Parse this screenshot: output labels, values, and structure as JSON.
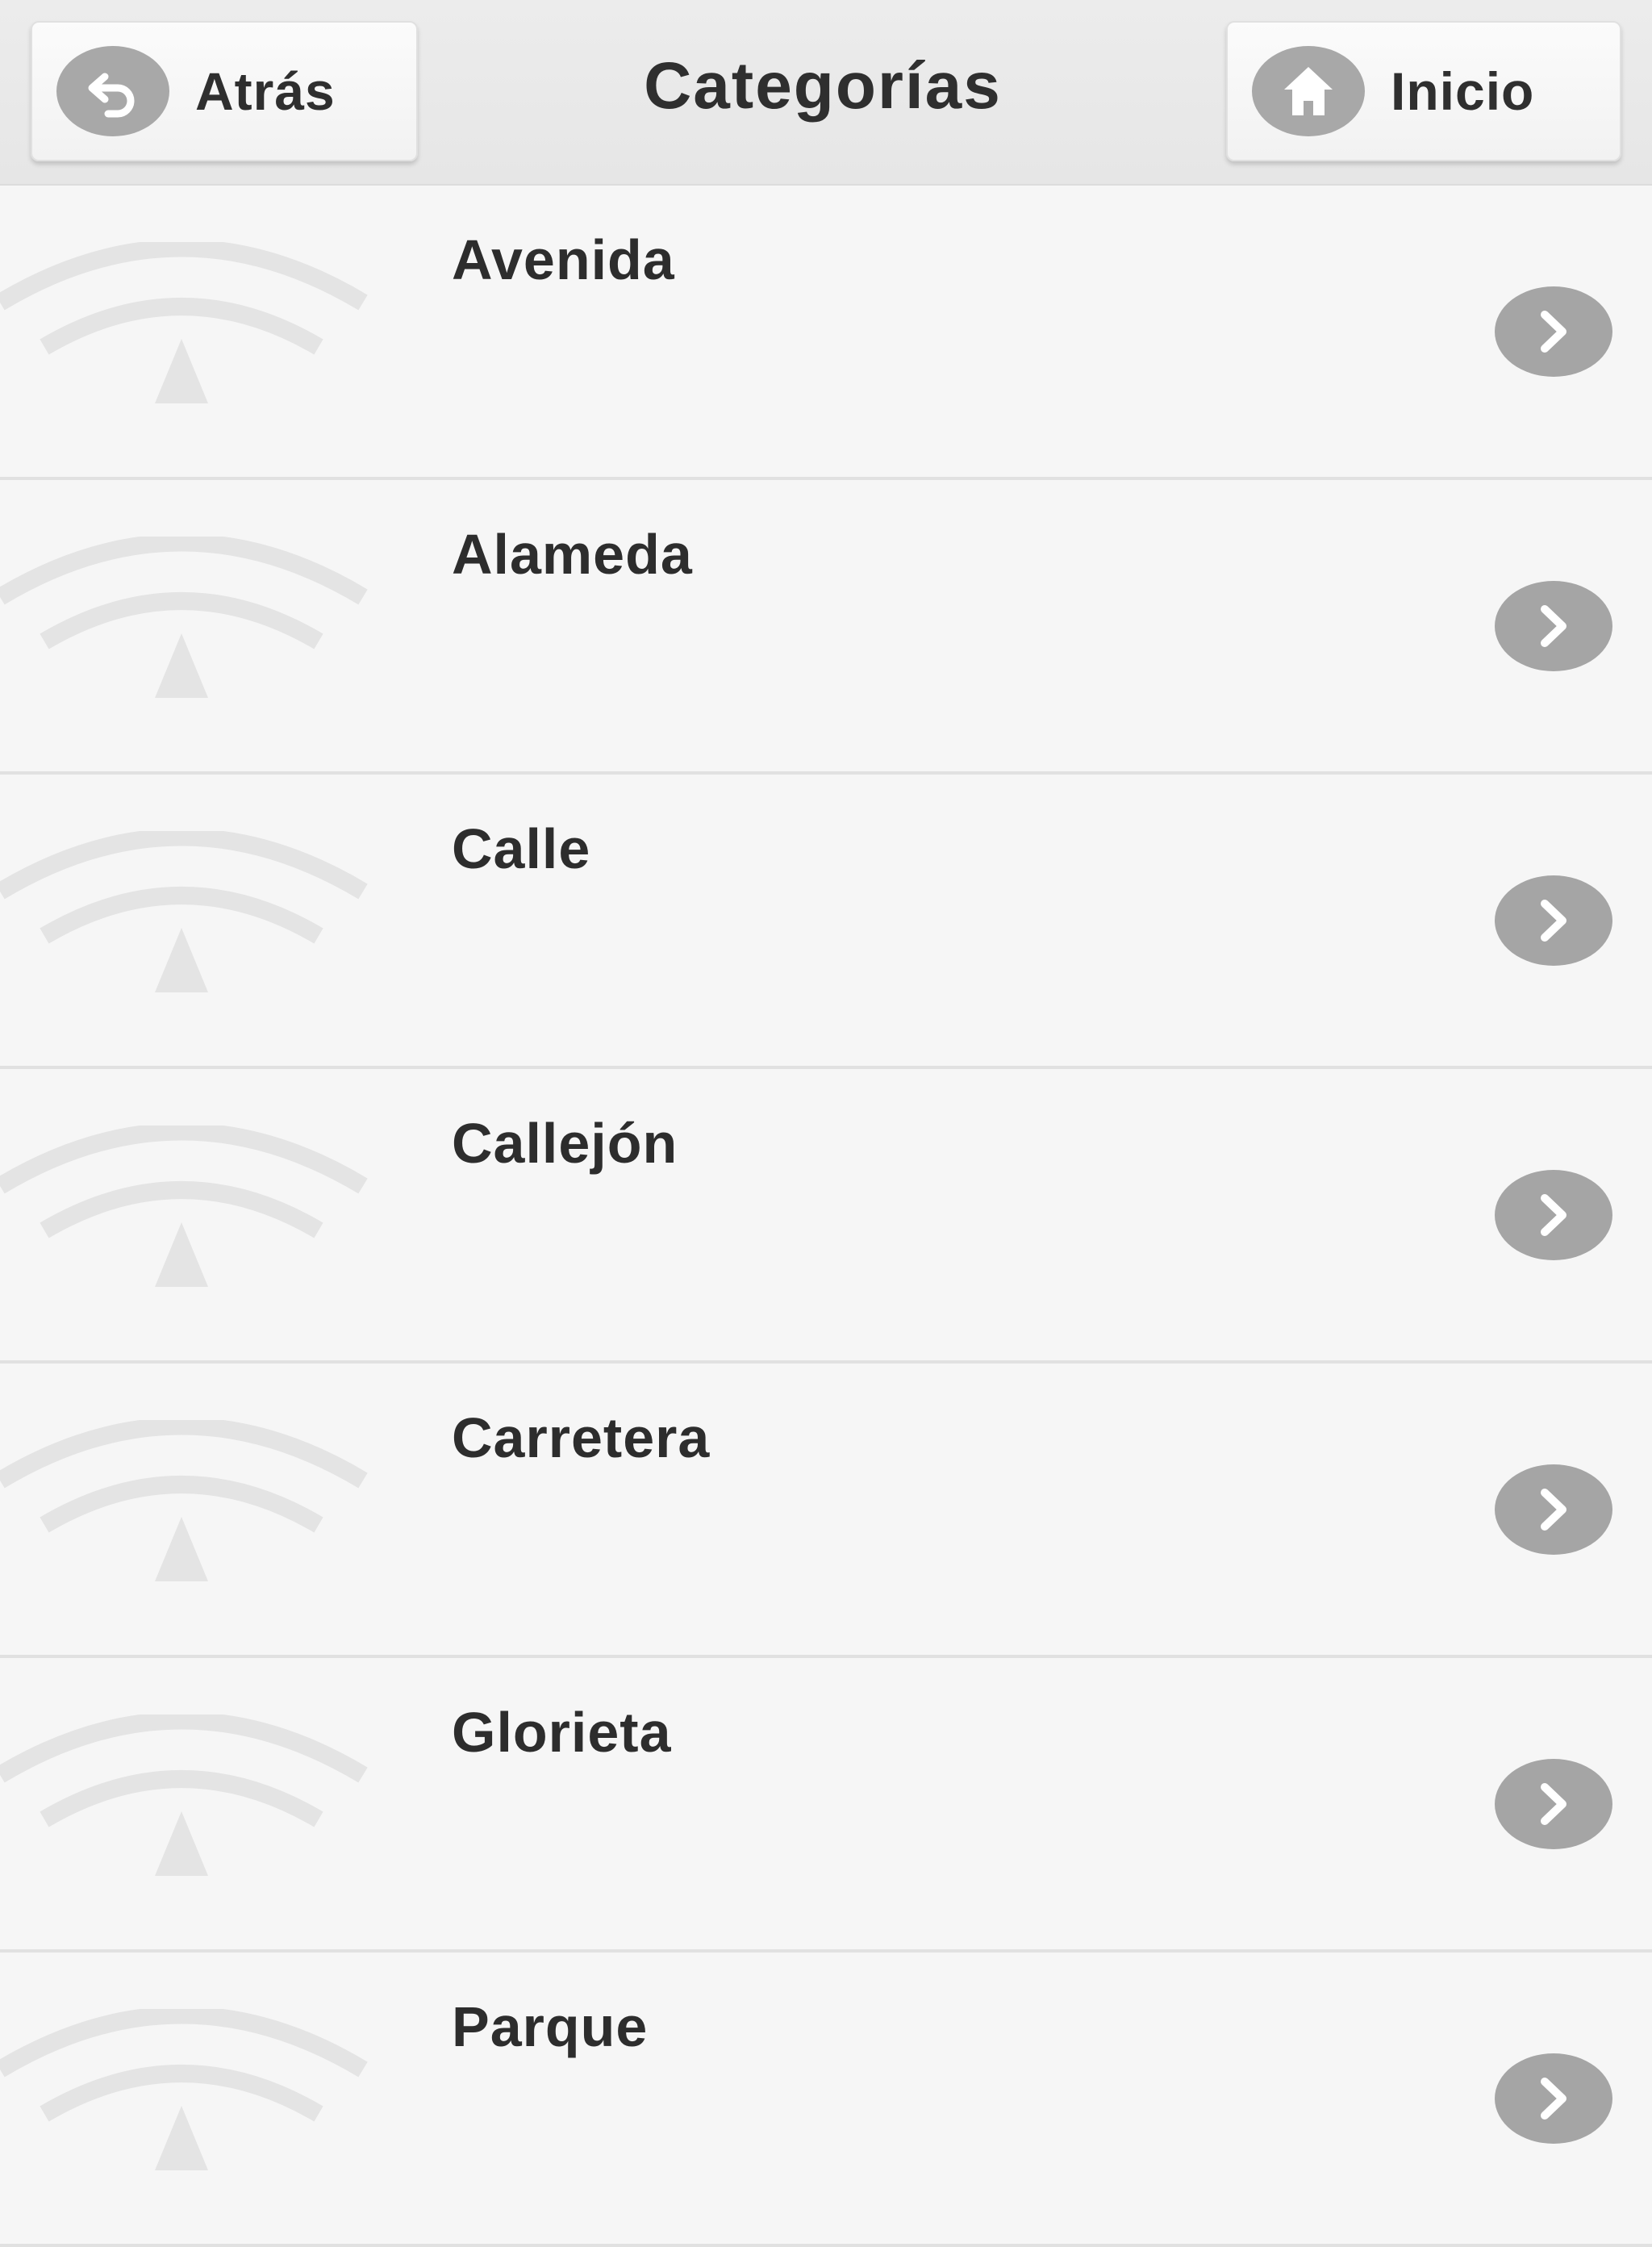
{
  "header": {
    "title": "Categorías",
    "back_label": "Atrás",
    "home_label": "Inicio"
  },
  "categories": [
    {
      "label": "Avenida"
    },
    {
      "label": "Alameda"
    },
    {
      "label": "Calle"
    },
    {
      "label": "Callejón"
    },
    {
      "label": "Carretera"
    },
    {
      "label": "Glorieta"
    },
    {
      "label": "Parque"
    }
  ],
  "icons": {
    "back": "back-arrow-icon",
    "home": "home-icon",
    "row_thumb": "logo-placeholder-icon",
    "row_chevron": "chevron-right-icon"
  },
  "colors": {
    "background": "#f6f6f6",
    "header": "#e8e8e8",
    "icon_gray": "#a8a8a8",
    "text": "#2f2f2f",
    "logo": "#e4e4e4"
  }
}
